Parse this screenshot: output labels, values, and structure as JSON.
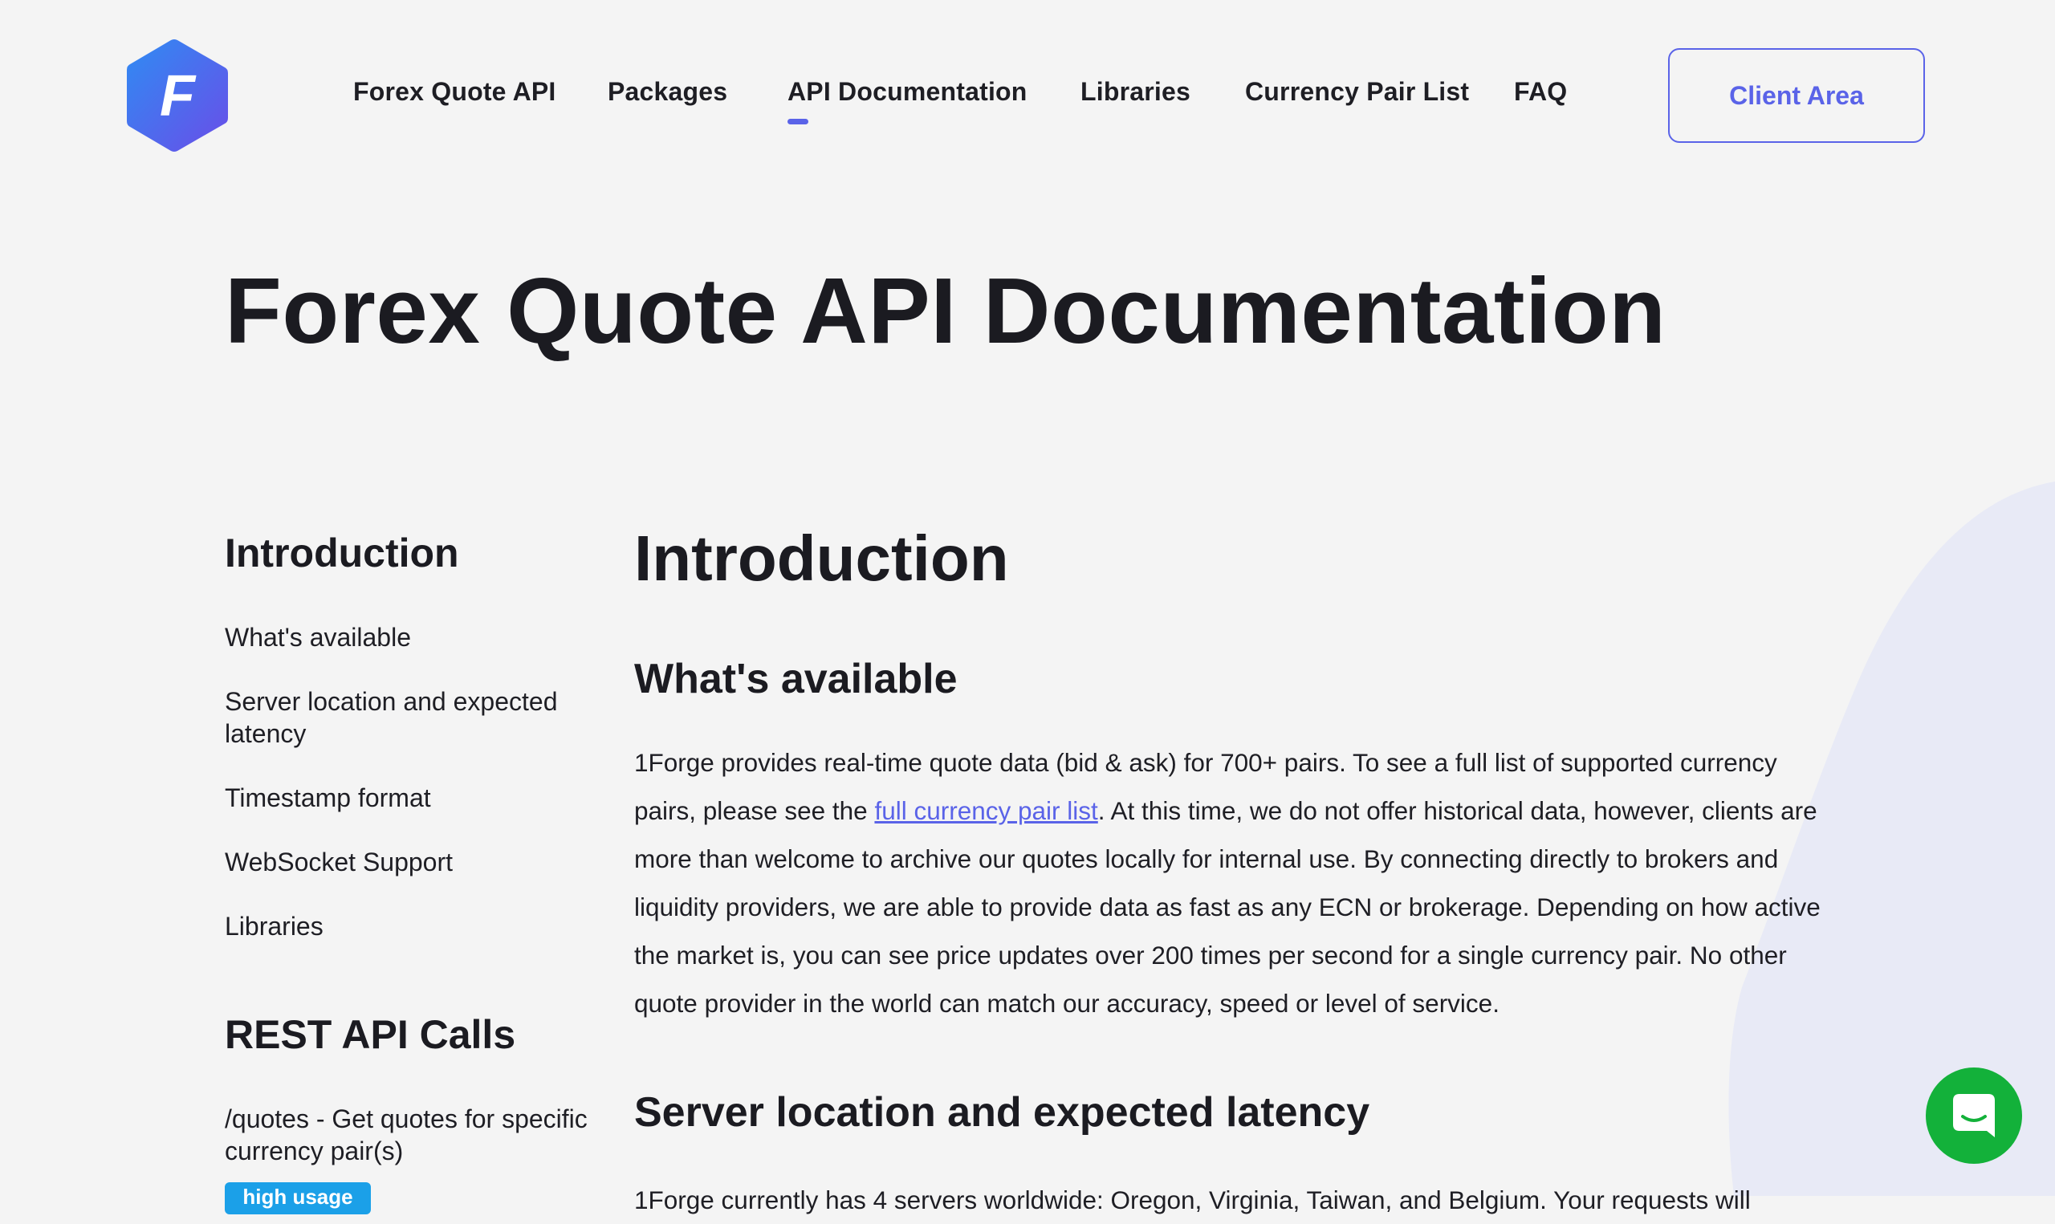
{
  "brand": {
    "logo_letter": "F",
    "logo_color": "#4a7cf0",
    "accent_color": "#5a63e8"
  },
  "nav": {
    "items": [
      {
        "label": "Forex Quote API",
        "active": false
      },
      {
        "label": "Packages",
        "active": false
      },
      {
        "label": "API Documentation",
        "active": true
      },
      {
        "label": "Libraries",
        "active": false
      },
      {
        "label": "Currency Pair List",
        "active": false
      },
      {
        "label": "FAQ",
        "active": false
      }
    ],
    "client_area_label": "Client Area"
  },
  "page": {
    "title": "Forex Quote API Documentation"
  },
  "sidebar": {
    "sections": [
      {
        "heading": "Introduction",
        "links": [
          "What's available",
          "Server location and expected latency",
          "Timestamp format",
          "WebSocket Support",
          "Libraries"
        ]
      },
      {
        "heading": "REST API Calls",
        "links": [
          "/quotes - Get quotes for specific currency pair(s)"
        ],
        "badge": "high usage"
      }
    ]
  },
  "main": {
    "section_title": "Introduction",
    "subsections": [
      {
        "title": "What's available",
        "paragraph": {
          "before_link": "1Forge provides real-time quote data (bid & ask) for 700+ pairs. To see a full list of supported currency pairs, please see the ",
          "link_text": "full currency pair list",
          "after_link": ". At this time, we do not offer historical data, however, clients are more than welcome to archive our quotes locally for internal use. By connecting directly to brokers and liquidity providers, we are able to provide data as fast as any ECN or brokerage. Depending on how active the market is, you can see price updates over 200 times per second for a single currency pair. No other quote provider in the world can match our accuracy, speed or level of service."
        }
      },
      {
        "title": "Server location and expected latency",
        "paragraph_partial": "1Forge currently has 4 servers worldwide: Oregon, Virginia, Taiwan, and Belgium. Your requests will"
      }
    ]
  },
  "chat": {
    "icon": "chat-icon",
    "color": "#13b13a"
  }
}
